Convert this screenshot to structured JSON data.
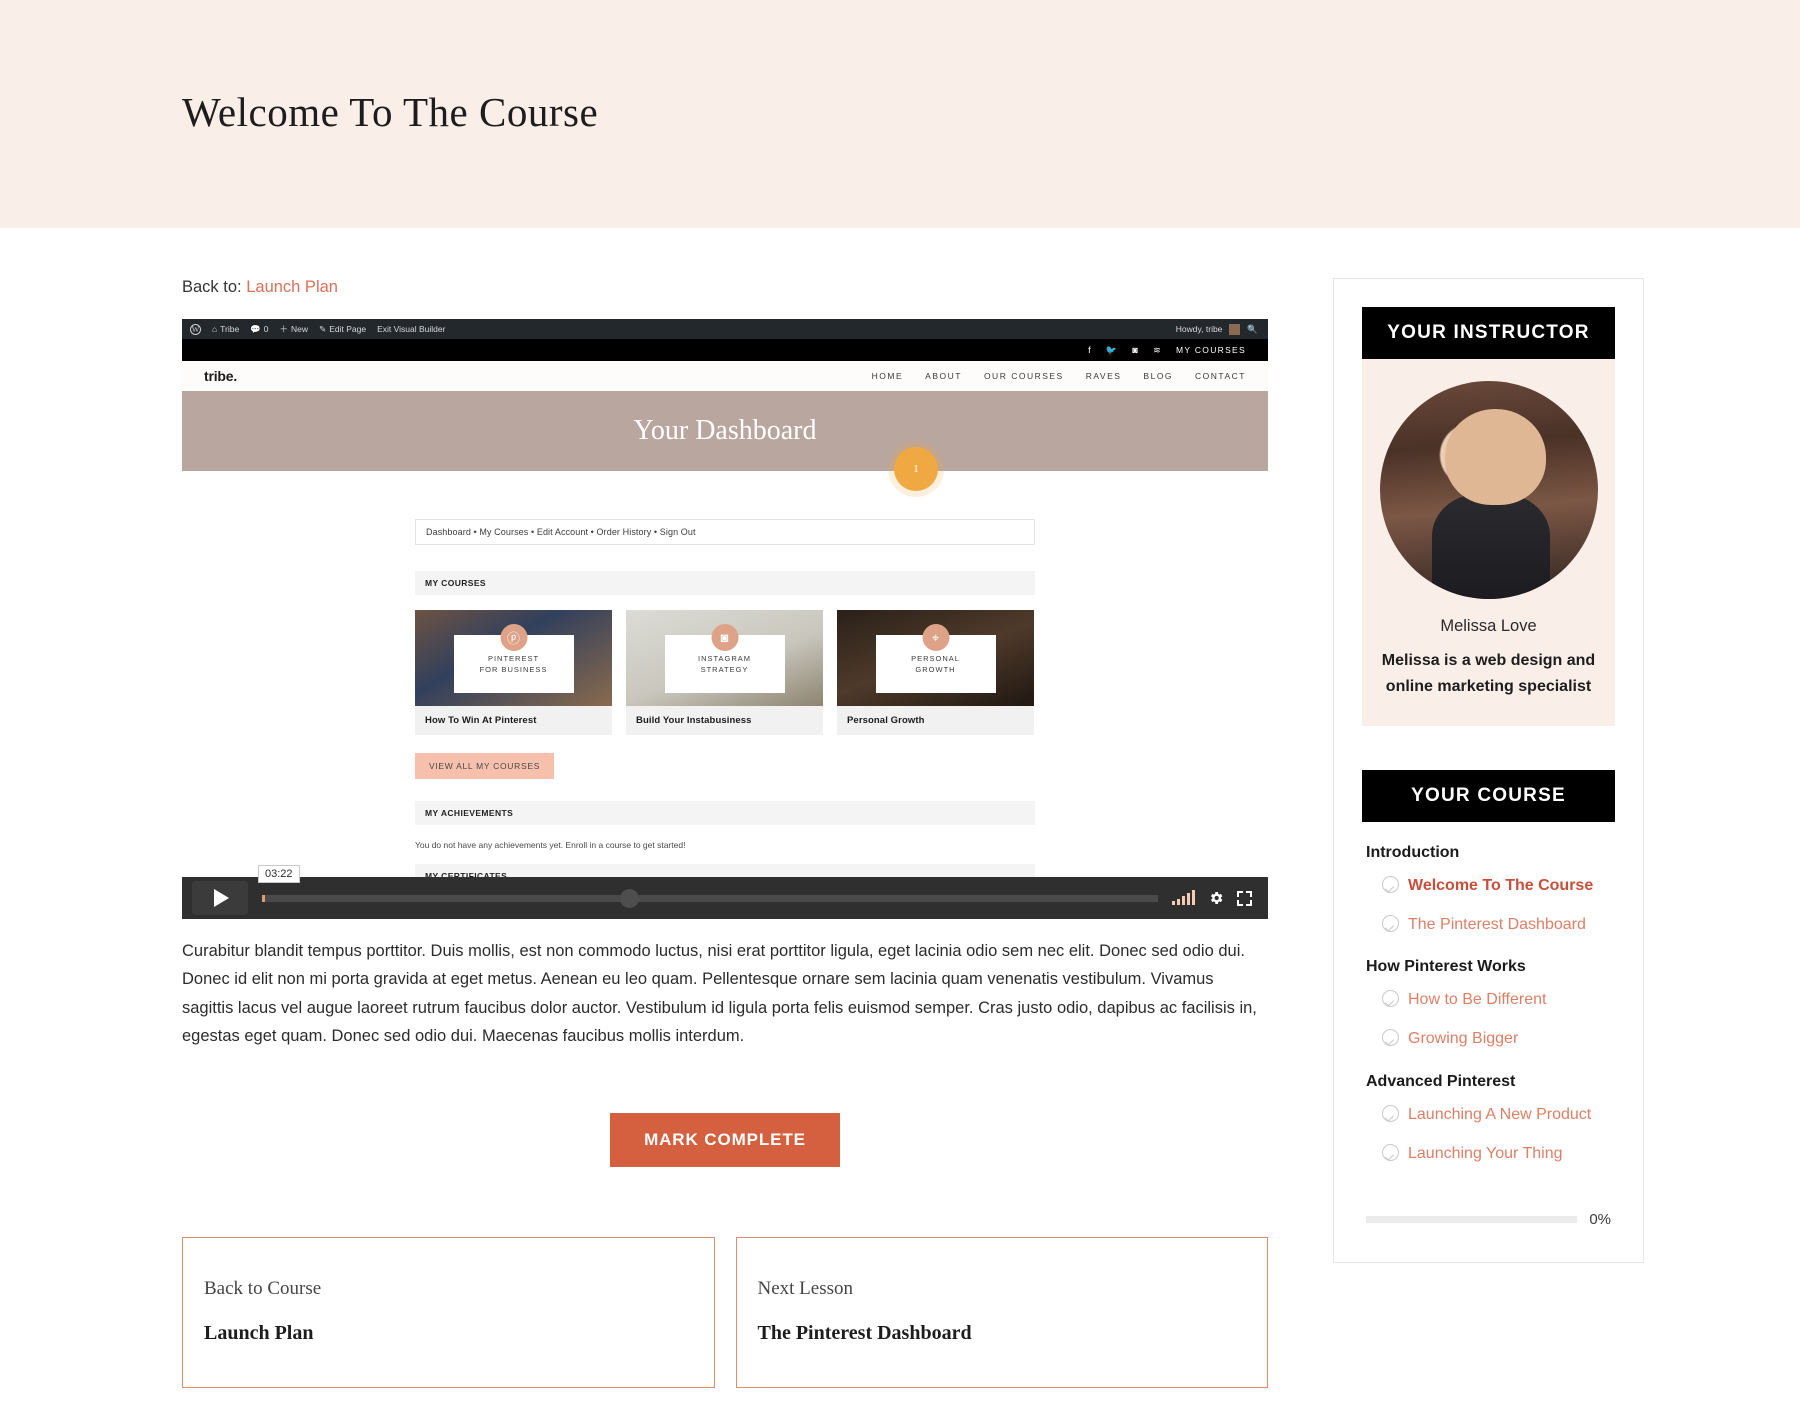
{
  "hero": {
    "title": "Welcome To The Course"
  },
  "breadcrumb": {
    "prefix": "Back to:",
    "link_label": "Launch Plan"
  },
  "video": {
    "admin_bar": {
      "logo_icon": "wordpress-icon",
      "site_name": "Tribe",
      "comments_count": "0",
      "new_label": "New",
      "edit_page_label": "Edit Page",
      "exit_builder_label": "Exit Visual Builder",
      "howdy_label": "Howdy, tribe",
      "search_icon": "search-icon"
    },
    "social_bar": {
      "icons": [
        "facebook-icon",
        "twitter-icon",
        "instagram-icon",
        "rss-icon"
      ],
      "my_courses_label": "MY COURSES"
    },
    "site_nav": {
      "logo": "tribe.",
      "items": [
        "HOME",
        "ABOUT",
        "OUR COURSES",
        "RAVES",
        "BLOG",
        "CONTACT"
      ]
    },
    "dashboard": {
      "hero_title": "Your Dashboard",
      "hotspot_label": "1",
      "subnav": "Dashboard • My Courses • Edit Account • Order History • Sign Out",
      "my_courses_heading": "MY COURSES",
      "cards": [
        {
          "badge_icon": "pinterest-icon",
          "overlay_line1": "PINTEREST",
          "overlay_line2": "FOR BUSINESS",
          "title": "How To Win At Pinterest"
        },
        {
          "badge_icon": "instagram-icon",
          "overlay_line1": "INSTAGRAM",
          "overlay_line2": "STRATEGY",
          "title": "Build Your Instabusiness"
        },
        {
          "badge_icon": "location-pin-icon",
          "overlay_line1": "PERSONAL",
          "overlay_line2": "GROWTH",
          "title": "Personal Growth"
        }
      ],
      "view_all_label": "VIEW ALL MY COURSES",
      "achievements_heading": "MY ACHIEVEMENTS",
      "achievements_note": "You do not have any achievements yet. Enroll in a course to get started!",
      "certificates_heading": "MY CERTIFICATES"
    },
    "controls": {
      "play_icon": "play-icon",
      "time": "03:22",
      "volume_icon": "volume-bars-icon",
      "settings_icon": "gear-icon",
      "fullscreen_icon": "fullscreen-icon"
    }
  },
  "lesson": {
    "body": "Curabitur blandit tempus porttitor. Duis mollis, est non commodo luctus, nisi erat porttitor ligula, eget lacinia odio sem nec elit. Donec sed odio dui. Donec id elit non mi porta gravida at eget metus. Aenean eu leo quam. Pellentesque ornare sem lacinia quam venenatis vestibulum. Vivamus sagittis lacus vel augue laoreet rutrum faucibus dolor auctor. Vestibulum id ligula porta felis euismod semper. Cras justo odio, dapibus ac facilisis in, egestas eget quam. Donec sed odio dui. Maecenas faucibus mollis interdum.",
    "mark_complete_label": "MARK COMPLETE"
  },
  "nav_boxes": {
    "back": {
      "kicker": "Back to Course",
      "title": "Launch Plan"
    },
    "next": {
      "kicker": "Next Lesson",
      "title": "The Pinterest Dashboard"
    }
  },
  "sidebar": {
    "instructor": {
      "heading": "YOUR INSTRUCTOR",
      "avatar_icon": "instructor-avatar",
      "name": "Melissa Love",
      "bio": "Melissa is a web design and online marketing specialist"
    },
    "course": {
      "heading": "YOUR COURSE",
      "sections": [
        {
          "title": "Introduction",
          "lessons": [
            {
              "label": "Welcome To The Course",
              "active": true,
              "status_icon": "check-circle-icon"
            },
            {
              "label": "The Pinterest Dashboard",
              "active": false,
              "status_icon": "check-circle-icon"
            }
          ]
        },
        {
          "title": "How Pinterest Works",
          "lessons": [
            {
              "label": "How to Be Different",
              "active": false,
              "status_icon": "check-circle-icon"
            },
            {
              "label": "Growing Bigger",
              "active": false,
              "status_icon": "check-circle-icon"
            }
          ]
        },
        {
          "title": "Advanced Pinterest",
          "lessons": [
            {
              "label": "Launching A New Product",
              "active": false,
              "status_icon": "check-circle-icon"
            },
            {
              "label": "Launching Your Thing",
              "active": false,
              "status_icon": "check-circle-icon"
            }
          ]
        }
      ],
      "progress_percent_label": "0%",
      "progress_value": 0
    }
  },
  "colors": {
    "hero_bg": "#faeee8",
    "accent": "#d4603f",
    "link": "#d9705a",
    "panel_header_bg": "#000000"
  }
}
